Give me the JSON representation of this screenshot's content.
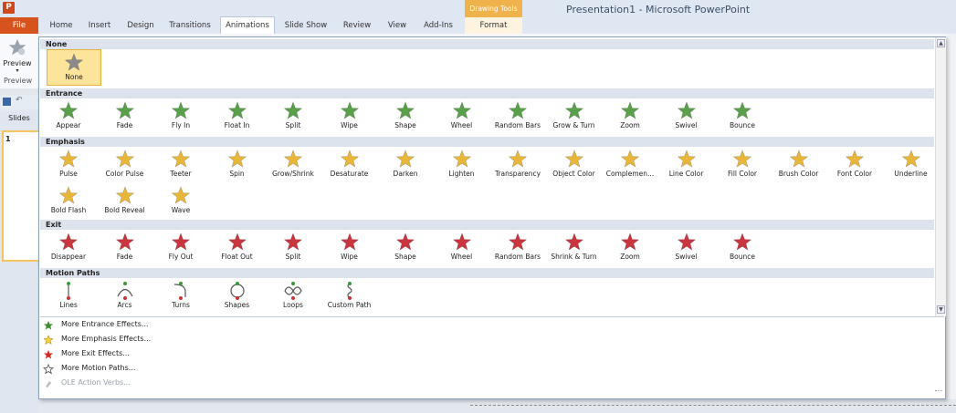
{
  "window": {
    "title": "Presentation1 - Microsoft PowerPoint",
    "app_icon": "P",
    "contextual_group": "Drawing Tools"
  },
  "tabs": [
    {
      "label": "File"
    },
    {
      "label": "Home"
    },
    {
      "label": "Insert"
    },
    {
      "label": "Design"
    },
    {
      "label": "Transitions"
    },
    {
      "label": "Animations"
    },
    {
      "label": "Slide Show"
    },
    {
      "label": "Review"
    },
    {
      "label": "View"
    },
    {
      "label": "Add-Ins"
    },
    {
      "label": "Format"
    }
  ],
  "ribbon": {
    "preview_label": "Preview",
    "preview_group": "Preview",
    "slides_tab": "Slides",
    "slide_number": "1"
  },
  "sections": {
    "none": {
      "title": "None",
      "items": [
        {
          "label": "None"
        }
      ]
    },
    "entrance": {
      "title": "Entrance",
      "items": [
        {
          "label": "Appear"
        },
        {
          "label": "Fade"
        },
        {
          "label": "Fly In"
        },
        {
          "label": "Float In"
        },
        {
          "label": "Split"
        },
        {
          "label": "Wipe"
        },
        {
          "label": "Shape"
        },
        {
          "label": "Wheel"
        },
        {
          "label": "Random Bars"
        },
        {
          "label": "Grow & Turn"
        },
        {
          "label": "Zoom"
        },
        {
          "label": "Swivel"
        },
        {
          "label": "Bounce"
        }
      ]
    },
    "emphasis": {
      "title": "Emphasis",
      "items": [
        {
          "label": "Pulse"
        },
        {
          "label": "Color Pulse"
        },
        {
          "label": "Teeter"
        },
        {
          "label": "Spin"
        },
        {
          "label": "Grow/Shrink"
        },
        {
          "label": "Desaturate"
        },
        {
          "label": "Darken"
        },
        {
          "label": "Lighten"
        },
        {
          "label": "Transparency"
        },
        {
          "label": "Object Color"
        },
        {
          "label": "Complemen..."
        },
        {
          "label": "Line Color"
        },
        {
          "label": "Fill Color"
        },
        {
          "label": "Brush Color"
        },
        {
          "label": "Font Color"
        },
        {
          "label": "Underline"
        },
        {
          "label": "Bold Flash"
        },
        {
          "label": "Bold Reveal"
        },
        {
          "label": "Wave"
        }
      ]
    },
    "exit": {
      "title": "Exit",
      "items": [
        {
          "label": "Disappear"
        },
        {
          "label": "Fade"
        },
        {
          "label": "Fly Out"
        },
        {
          "label": "Float Out"
        },
        {
          "label": "Split"
        },
        {
          "label": "Wipe"
        },
        {
          "label": "Shape"
        },
        {
          "label": "Wheel"
        },
        {
          "label": "Random Bars"
        },
        {
          "label": "Shrink & Turn"
        },
        {
          "label": "Zoom"
        },
        {
          "label": "Swivel"
        },
        {
          "label": "Bounce"
        }
      ]
    },
    "motion": {
      "title": "Motion Paths",
      "items": [
        {
          "label": "Lines"
        },
        {
          "label": "Arcs"
        },
        {
          "label": "Turns"
        },
        {
          "label": "Shapes"
        },
        {
          "label": "Loops"
        },
        {
          "label": "Custom Path"
        }
      ]
    }
  },
  "more_effects": [
    {
      "label": "More Entrance Effects...",
      "icon": "entrance-star-icon"
    },
    {
      "label": "More Emphasis Effects...",
      "icon": "emphasis-star-icon"
    },
    {
      "label": "More Exit Effects...",
      "icon": "exit-star-icon"
    },
    {
      "label": "More Motion Paths...",
      "icon": "motion-path-star-icon"
    },
    {
      "label": "OLE Action Verbs...",
      "icon": "ole-verbs-icon",
      "disabled": true
    }
  ],
  "colors": {
    "entrance": "#5aa04a",
    "emphasis": "#e8b73a",
    "exit": "#c9363f",
    "motion": "#3a8a3a",
    "none": "#8a8a8a",
    "selected": "#fde49b"
  }
}
